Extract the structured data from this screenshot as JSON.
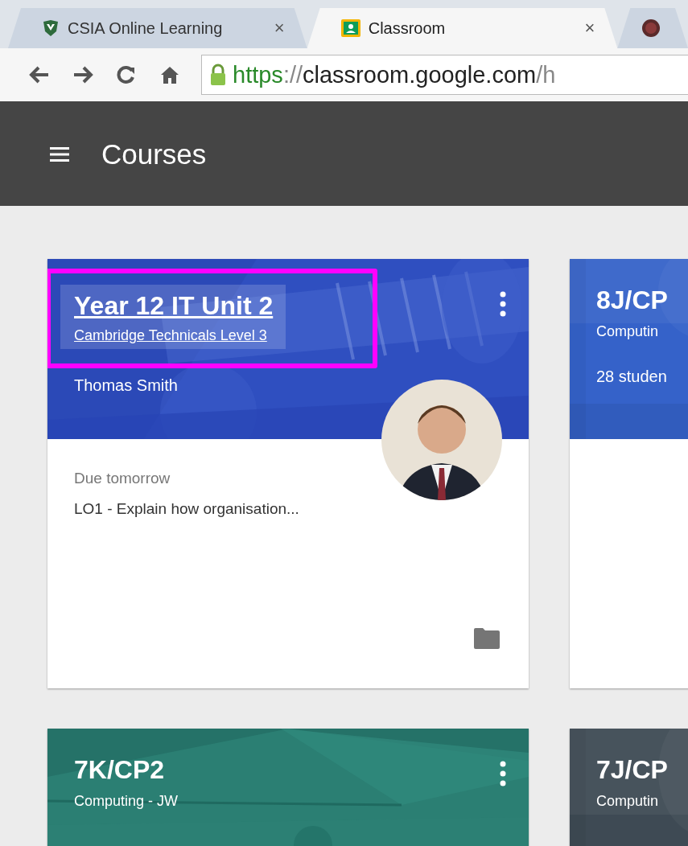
{
  "browser": {
    "tabs": [
      {
        "title": "CSIA Online Learning",
        "close": "×",
        "selected": false
      },
      {
        "title": "Classroom",
        "close": "×",
        "selected": true
      },
      {
        "selected": false
      }
    ],
    "address": {
      "scheme": "https",
      "separator": "://",
      "host": "classroom.google.com",
      "path": "/h"
    }
  },
  "app_bar": {
    "title": "Courses"
  },
  "courses": [
    {
      "title": "Year 12 IT Unit 2",
      "subtitle": "Cambridge Technicals Level 3",
      "teacher": "Thomas Smith",
      "color": "#2f4fc0",
      "kind": "picture",
      "menu": true,
      "highlighted": true,
      "avatar": true,
      "due_label": "Due tomorrow",
      "due_item": "LO1 - Explain how organisation...",
      "folder": true
    },
    {
      "title": "8J/CP",
      "subtitle": "Computin",
      "students": "28 studen",
      "color": "#3562c9",
      "kind": "plain",
      "menu": false,
      "highlighted": false,
      "avatar": false,
      "folder": false
    },
    {
      "title": "7K/CP2",
      "subtitle": "Computing - JW",
      "color": "#2b7f73",
      "kind": "picture",
      "menu": true,
      "highlighted": false,
      "avatar": false,
      "folder": false
    },
    {
      "title": "7J/CP",
      "subtitle": "Computin",
      "color": "#3e4a54",
      "kind": "plain",
      "menu": false,
      "highlighted": false,
      "avatar": false,
      "folder": false
    }
  ]
}
